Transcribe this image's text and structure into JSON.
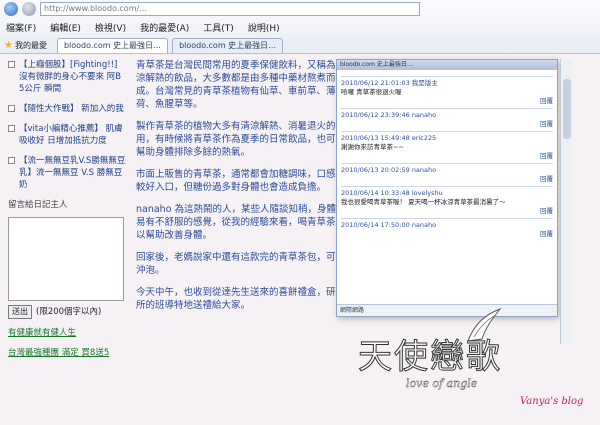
{
  "browser": {
    "address": "http://www.bloodo.com/...",
    "menu": [
      "檔案(F)",
      "編輯(E)",
      "檢視(V)",
      "我的最愛(A)",
      "工具(T)",
      "說明(H)"
    ],
    "favorites_label": "我的最愛",
    "tabs": [
      "bloodo.com 史上最強日…",
      "bloodo.com 史上最強日…"
    ]
  },
  "sidebar": {
    "items": [
      "【上癮個股】[Fighting!!] 沒有微胖的身心不要來 阿B 5公斤 瞬間",
      "【隨性大作戰】 新加入的我",
      "【vita小編精心推薦】 肌膚吸收好 日增加抵抗力度",
      "【流一無無豆乳V.S勝無無豆乳】流一無無豆 V.S 勝無豆奶"
    ],
    "message_title": "留言給日記主人",
    "send_label": "送出",
    "limit_text": "(限200個字以內)",
    "green_links": [
      "有健康就有健人生",
      "台灣最強種團 滿定 買8送5"
    ]
  },
  "article": {
    "paragraphs": [
      "青草茶是台灣民間常用的夏季保健飲料，又稱為清涼解熱的飲品，大多數都是由多種中藥材熬煮而成。台灣常見的青草茶植物有仙草、車前草、薄荷、魚腥草等。",
      "製作青草茶的植物大多有清涼解熱、消暑退火的作用，有時候將青草茶作為夏季的日常飲品，也可以幫助身體排除多餘的熱氣。",
      "市面上販售的青草茶，通常都會加糖調味，口感比較好入口，但糖份過多對身體也會造成負擔。",
      "nanaho 為這熱鬧的人，某些人隨談知稍，身體容易有不舒服的感覺，從我的經驗來看，喝青草茶可以幫助改善身體。",
      "回家後，老媽說家中還有這款完的青草茶包，可以沖泡。",
      "今天中午，也收到從達先生送來的喜餅禮盒，研究所的班導特地送禮給大家。"
    ]
  },
  "floating_window": {
    "title": "bloodo.com 史上最強日…",
    "entries": [
      {
        "meta": "2010/06/12 21:01:03",
        "user": "我是版主",
        "text": "哈囉\n青草茶很退火喔",
        "reply": "回覆"
      },
      {
        "meta": "2010/06/12 23:39:46",
        "user": "nanaho",
        "text": "",
        "reply": "回覆"
      },
      {
        "meta": "2010/06/13 15:49:48",
        "user": "eric225",
        "text": "謝謝你來訪青草茶~~",
        "reply": "回覆"
      },
      {
        "meta": "2010/06/13 20:02:59",
        "user": "nanaho",
        "text": "",
        "reply": "回覆"
      },
      {
        "meta": "2010/06/14 10:33:48",
        "user": "lovelyshu",
        "text": "我也很愛喝青草茶喔！ 夏天喝一杯冰涼青草茶最消暑了～",
        "reply": "回覆"
      },
      {
        "meta": "2010/06/14 17:50:00",
        "user": "nanaho",
        "text": "",
        "reply": "回覆"
      }
    ],
    "status": "網際網路"
  },
  "logo": {
    "title": "天使戀歌",
    "subtitle": "love of angle"
  },
  "signature": "Vanya's blog",
  "colors": {
    "link": "#2a4c9a",
    "accent": "#b3245d"
  }
}
